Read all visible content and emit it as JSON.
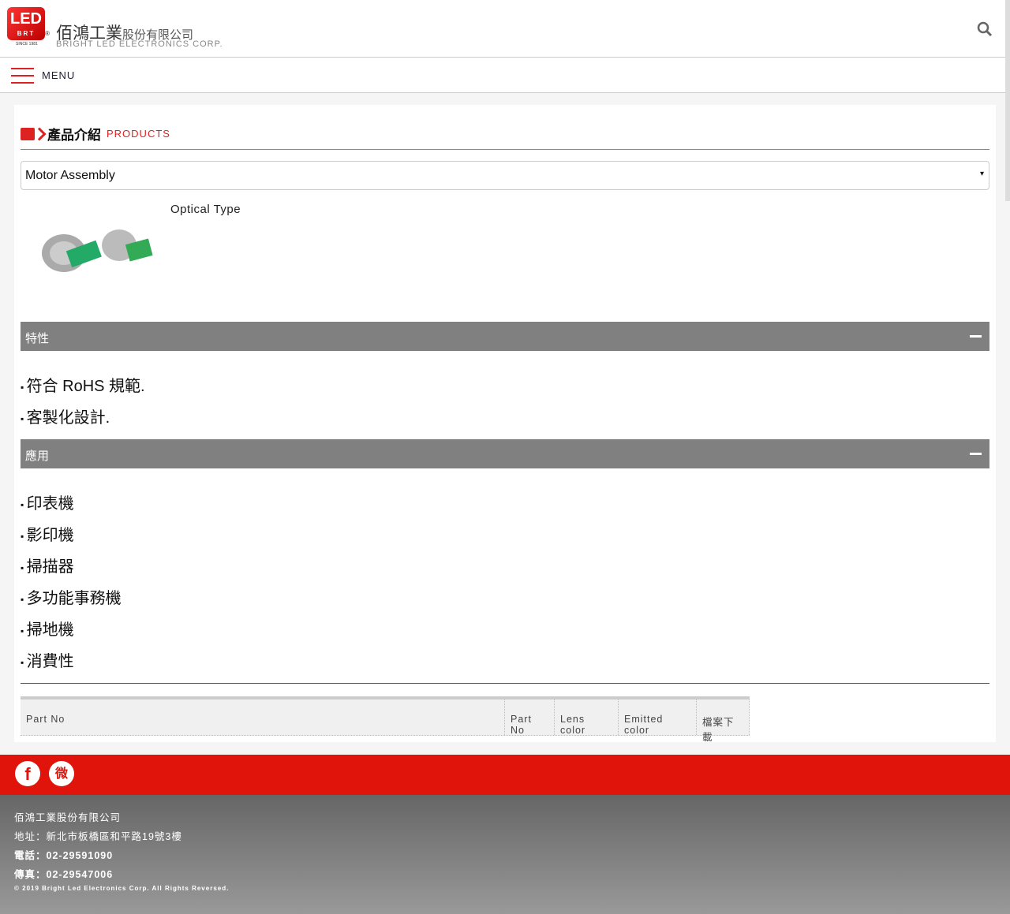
{
  "header": {
    "logo_text": "LED",
    "logo_sub": "BRT",
    "since": "SINCE 1981",
    "company_zh_main": "佰鴻工業",
    "company_zh_suffix": "股份有限公司",
    "company_en": "BRIGHT LED ELECTRONICS CORP."
  },
  "menu": {
    "label": "MENU"
  },
  "section": {
    "title_zh": "產品介紹",
    "title_en": "PRODUCTS"
  },
  "select": {
    "value": "Motor Assembly",
    "arrow": "▾"
  },
  "product": {
    "type": "Optical Type"
  },
  "features": {
    "title": "特性",
    "items": [
      "符合 RoHS 規範.",
      "客製化設計."
    ]
  },
  "applications": {
    "title": "應用",
    "items": [
      "印表機",
      "影印機",
      "掃描器",
      "多功能事務機",
      "掃地機",
      "消費性"
    ]
  },
  "table": {
    "headers": [
      "Part No",
      "Part No",
      "Lens color",
      "Emitted color",
      "檔案下載"
    ]
  },
  "social": {
    "facebook": "f",
    "weibo": "微"
  },
  "footer": {
    "company": "佰鴻工業股份有限公司",
    "address": "地址：新北市板橋區和平路19號3樓",
    "phone": "電話：02-29591090",
    "fax": "傳真：02-29547006",
    "copyright": "© 2019 Bright Led Electronics Corp. All Rights Reversed."
  },
  "colors": {
    "brand": "#e0140a",
    "accordion": "#808080"
  }
}
